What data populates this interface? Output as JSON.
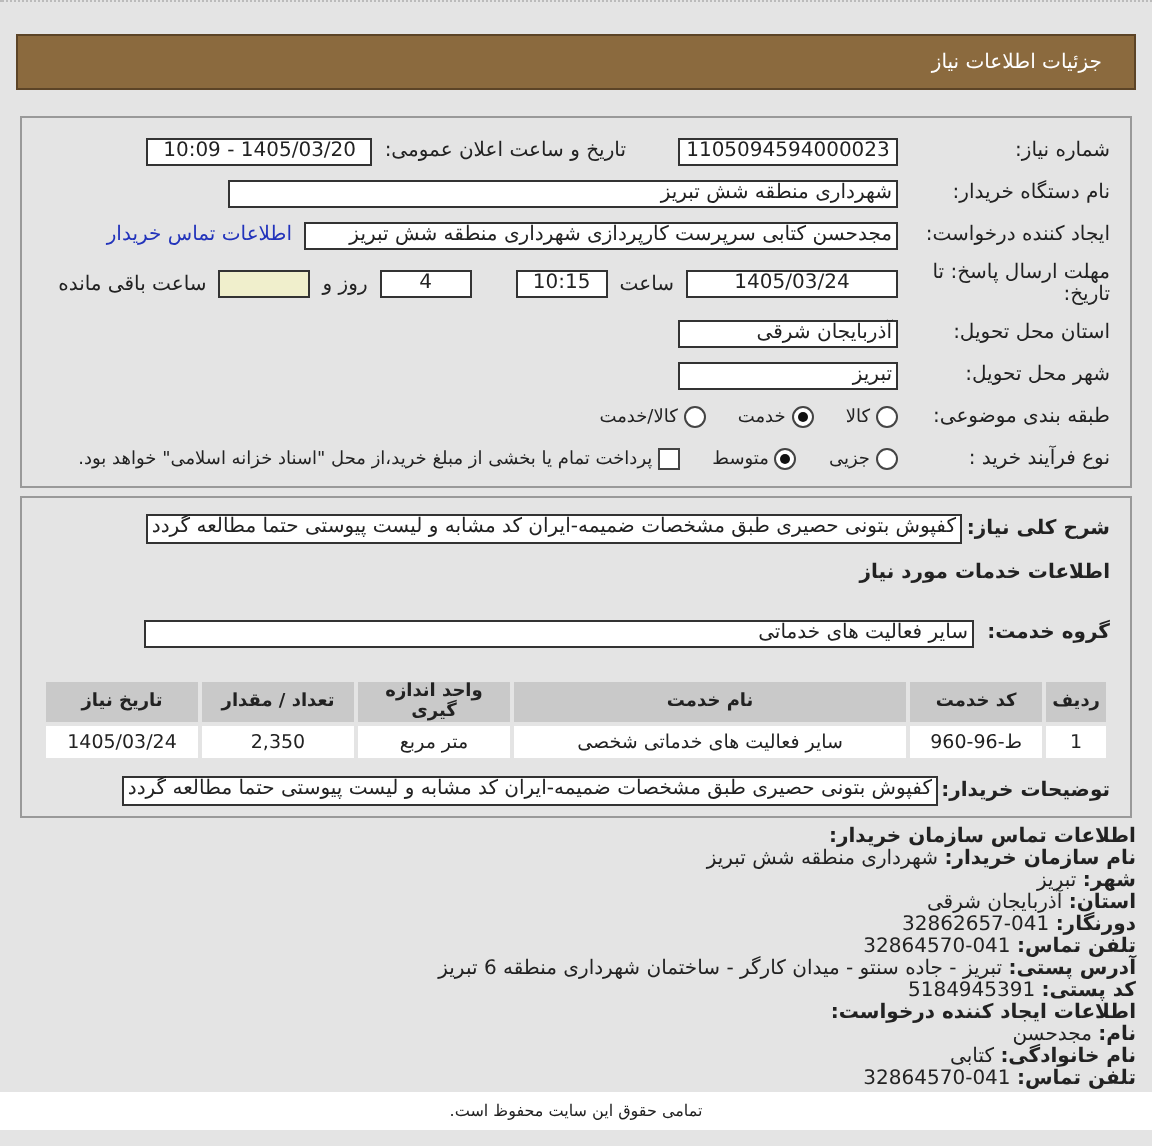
{
  "header": {
    "title": "جزئیات اطلاعات نیاز"
  },
  "form": {
    "need_number": {
      "label": "شماره نیاز:",
      "value": "1105094594000023"
    },
    "announce": {
      "label": "تاریخ و ساعت اعلان عمومی:",
      "value": "1405/03/20 - 10:09"
    },
    "buyer": {
      "label": "نام دستگاه خریدار:",
      "value": "شهرداری منطقه شش تبریز"
    },
    "requester": {
      "label": "ایجاد کننده درخواست:",
      "value": "مجدحسن کتابی سرپرست کارپردازی شهرداری منطقه شش تبریز",
      "link": "اطلاعات تماس خریدار"
    },
    "deadline": {
      "label": "مهلت ارسال پاسخ: تا تاریخ:",
      "date": "1405/03/24",
      "time_label": "ساعت",
      "time": "10:15",
      "days": "4",
      "days_label": "روز و",
      "remaining_label": "ساعت باقی مانده"
    },
    "province": {
      "label": "استان محل تحویل:",
      "value": "آذربایجان شرقی"
    },
    "city": {
      "label": "شهر محل تحویل:",
      "value": "تبریز"
    },
    "category": {
      "label": "طبقه بندی موضوعی:",
      "options": [
        {
          "label": "کالا",
          "selected": false
        },
        {
          "label": "خدمت",
          "selected": true
        },
        {
          "label": "کالا/خدمت",
          "selected": false
        }
      ]
    },
    "process": {
      "label": "نوع فرآیند خرید :",
      "options": [
        {
          "label": "جزیی",
          "selected": false
        },
        {
          "label": "متوسط",
          "selected": true
        }
      ],
      "payment": {
        "checked": false,
        "label": "پرداخت تمام یا بخشی از مبلغ خرید،از محل \"اسناد خزانه اسلامی\" خواهد بود."
      }
    }
  },
  "details": {
    "summary": {
      "label": "شرح کلی نیاز:",
      "value": "کفپوش بتونی حصیری طبق مشخصات ضمیمه-ایران کد مشابه و لیست پیوستی حتما مطالعه گردد"
    },
    "services_title": "اطلاعات خدمات مورد نیاز",
    "service_group": {
      "label": "گروه خدمت:",
      "value": "سایر فعالیت های خدماتی"
    },
    "table": {
      "columns": [
        "ردیف",
        "کد خدمت",
        "نام خدمت",
        "واحد اندازه گیری",
        "تعداد / مقدار",
        "تاریخ نیاز"
      ],
      "rows": [
        [
          "1",
          "ط-96-960",
          "سایر فعالیت های خدماتی شخصی",
          "متر مربع",
          "2,350",
          "1405/03/24"
        ]
      ]
    },
    "buyer_notes": {
      "label": "توضیحات خریدار:",
      "value": "کفپوش بتونی حصیری طبق مشخصات ضمیمه-ایران کد مشابه و لیست پیوستی حتما مطالعه گردد"
    }
  },
  "contact": {
    "title": "اطلاعات تماس سازمان خریدار:",
    "lines": [
      {
        "label": "نام سازمان خریدار:",
        "value": "شهرداری منطقه شش تبریز"
      },
      {
        "label": "شهر:",
        "value": "تبریز"
      },
      {
        "label": "استان:",
        "value": "آذربایجان شرقی"
      },
      {
        "label": "دورنگار:",
        "value": "041-32862657"
      },
      {
        "label": "تلفن تماس:",
        "value": "041-32864570"
      },
      {
        "label": "آدرس پستی:",
        "value": "تبریز - جاده سنتو - میدان کارگر - ساختمان شهرداری منطقه 6 تبریز"
      },
      {
        "label": "کد پستی:",
        "value": "5184945391"
      }
    ],
    "creator_title": "اطلاعات ایجاد کننده درخواست:",
    "creator_lines": [
      {
        "label": "نام:",
        "value": "مجدحسن"
      },
      {
        "label": "نام خانوادگی:",
        "value": "کتابی"
      },
      {
        "label": "تلفن تماس:",
        "value": "041-32864570"
      }
    ]
  },
  "footer": {
    "text": "تمامی حقوق این سایت محفوظ است."
  }
}
